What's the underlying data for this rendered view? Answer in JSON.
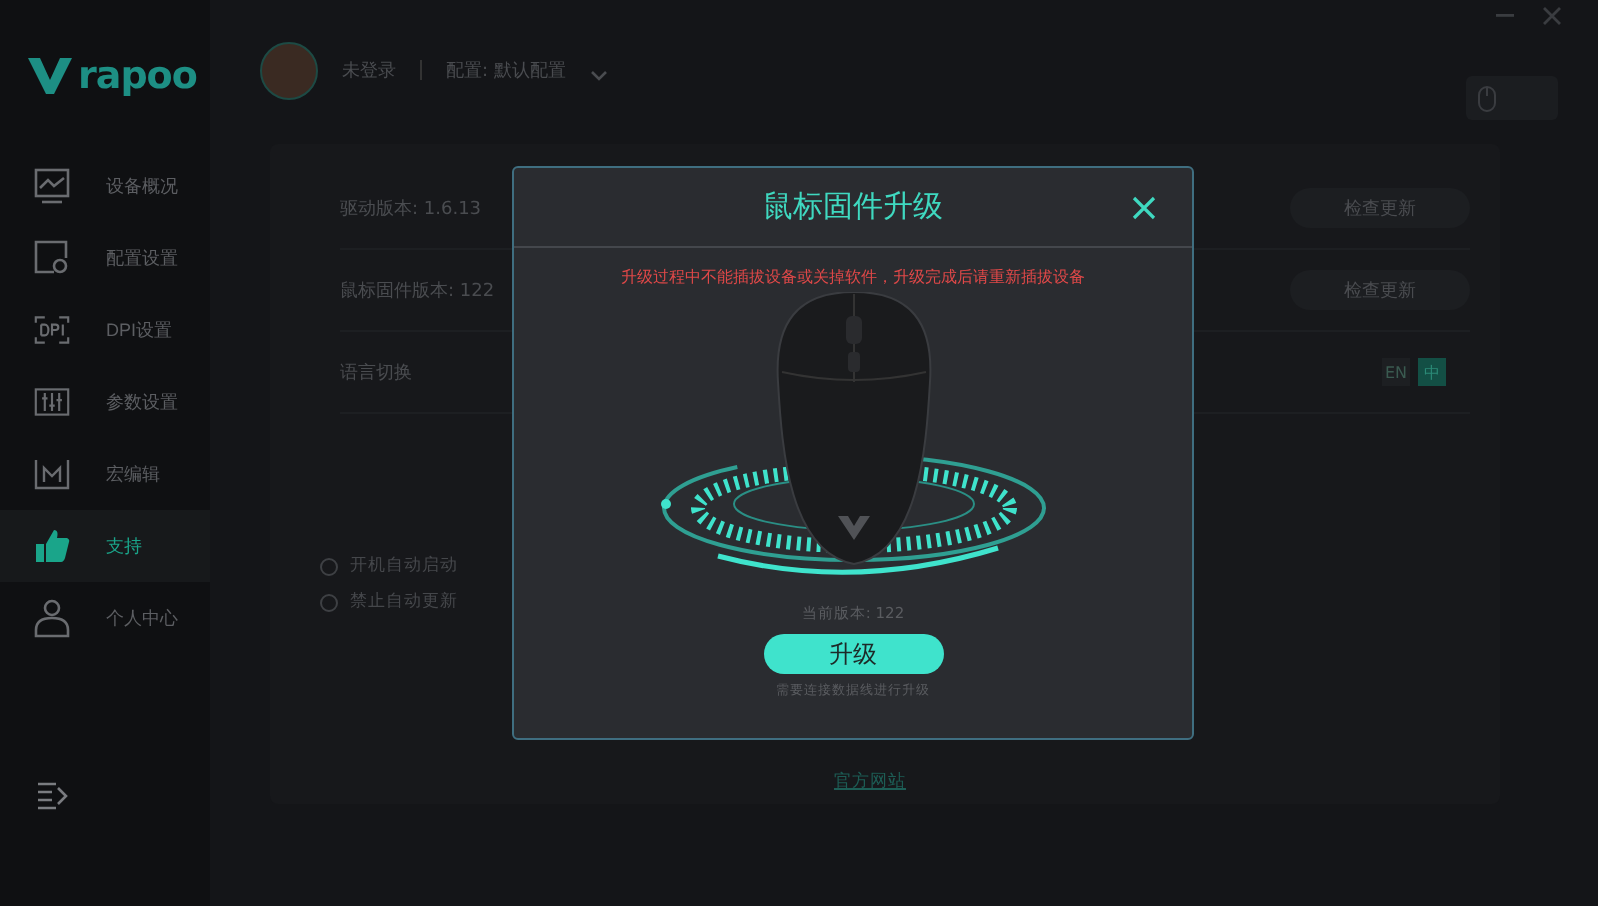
{
  "logo": {
    "text": "rapoo"
  },
  "sidebar": {
    "items": [
      {
        "label": "设备概况",
        "selected": false
      },
      {
        "label": "配置设置",
        "selected": false
      },
      {
        "label": "DPI设置",
        "selected": false
      },
      {
        "label": "参数设置",
        "selected": false
      },
      {
        "label": "宏编辑",
        "selected": false
      },
      {
        "label": "支持",
        "selected": true
      },
      {
        "label": "个人中心",
        "selected": false
      }
    ]
  },
  "header": {
    "user": "未登录",
    "profile": "配置: 默认配置"
  },
  "settings": {
    "rows": [
      {
        "kind": "version",
        "label": "驱动版本: 1.6.13",
        "button": "检查更新"
      },
      {
        "kind": "version",
        "label": "鼠标固件版本: 122",
        "button": "检查更新"
      },
      {
        "kind": "language",
        "label": "语言切换",
        "options": [
          {
            "label": "EN",
            "selected": false
          },
          {
            "label": "中",
            "selected": true
          }
        ]
      }
    ],
    "options": [
      {
        "label": "开机自动启动",
        "checked": false
      },
      {
        "label": "禁止自动更新",
        "checked": false
      }
    ],
    "link": "官方网站"
  },
  "dialog": {
    "title": "鼠标固件升级",
    "warning": "升级过程中不能插拔设备或关掉软件，升级完成后请重新插拔设备",
    "current_version": "当前版本: 122",
    "button": "升级",
    "note": "需要连接数据线进行升级"
  }
}
